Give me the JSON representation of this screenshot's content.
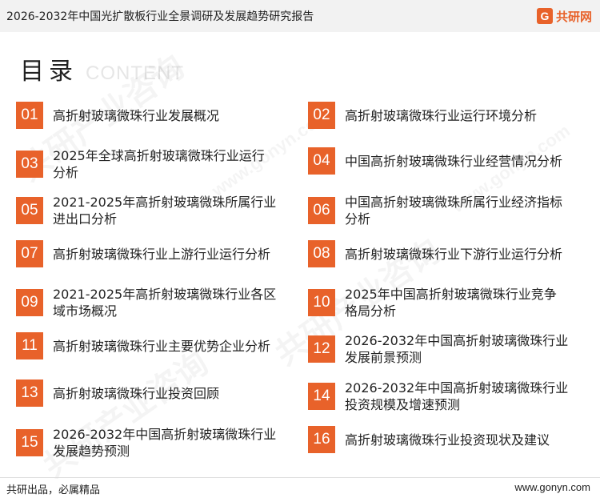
{
  "header": {
    "title": "2026-2032年中国光扩散板行业全景调研及发展趋势研究报告",
    "brand_mark": "G",
    "brand_name": "共研网"
  },
  "heading": {
    "title": "目录",
    "subtitle": "CONTENT"
  },
  "watermark": {
    "text": "共研产业咨询",
    "url": "www.gonyn.com"
  },
  "toc": [
    {
      "num": "01",
      "title": "高折射玻璃微珠行业发展概况"
    },
    {
      "num": "02",
      "title": "高折射玻璃微珠行业运行环境分析"
    },
    {
      "num": "03",
      "title": "2025年全球高折射玻璃微珠行业运行分析"
    },
    {
      "num": "04",
      "title": "中国高折射玻璃微珠行业经营情况分析"
    },
    {
      "num": "05",
      "title": "2021-2025年高折射玻璃微珠所属行业进出口分析"
    },
    {
      "num": "06",
      "title": "中国高折射玻璃微珠所属行业经济指标分析"
    },
    {
      "num": "07",
      "title": "高折射玻璃微珠行业上游行业运行分析"
    },
    {
      "num": "08",
      "title": "高折射玻璃微珠行业下游行业运行分析"
    },
    {
      "num": "09",
      "title": "2021-2025年高折射玻璃微珠行业各区域市场概况"
    },
    {
      "num": "10",
      "title": "2025年中国高折射玻璃微珠行业竞争格局分析"
    },
    {
      "num": "11",
      "title": "高折射玻璃微珠行业主要优势企业分析"
    },
    {
      "num": "12",
      "title": "2026-2032年中国高折射玻璃微珠行业发展前景预测"
    },
    {
      "num": "13",
      "title": "高折射玻璃微珠行业投资回顾"
    },
    {
      "num": "14",
      "title": "2026-2032年中国高折射玻璃微珠行业投资规模及增速预测"
    },
    {
      "num": "15",
      "title": "2026-2032年中国高折射玻璃微珠行业发展趋势预测"
    },
    {
      "num": "16",
      "title": "高折射玻璃微珠行业投资现状及建议"
    }
  ],
  "footer": {
    "slogan": "共研出品，必属精品",
    "url": "www.gonyn.com"
  },
  "colors": {
    "accent": "#e8622a"
  }
}
